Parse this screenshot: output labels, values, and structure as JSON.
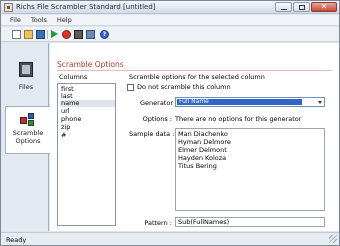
{
  "window": {
    "title": "Richs File Scrambler Standard [untitled]"
  },
  "menu": {
    "items": [
      "File",
      "Tools",
      "Help"
    ]
  },
  "toolbar": {
    "buttons": [
      "new-icon",
      "open-icon",
      "save-icon",
      "run-icon",
      "stop-icon",
      "settings-icon",
      "options-icon",
      "help-icon"
    ]
  },
  "nav": {
    "tabs": [
      {
        "label": "Files",
        "icon": "files-icon"
      },
      {
        "label": "Scramble Options",
        "icon": "scramble-icon",
        "active": true
      }
    ]
  },
  "main": {
    "section_title": "Scramble Options",
    "columns_header": "Columns",
    "columns": [
      "first",
      "last",
      "name",
      "url",
      "phone",
      "zip",
      "#"
    ],
    "selected_column": "name",
    "options_header": "Scramble options for the selected column",
    "dont_scramble_label": "Do not scramble this column",
    "dont_scramble_checked": false,
    "generator_label": "Generator :",
    "generator_value": "Full Name",
    "options_label": "Options :",
    "options_text": "There are no options for this generator",
    "sample_label": "Sample data :",
    "sample_data": [
      "Man Diachenko",
      "Hyman Delmore",
      "Elmer Delmont",
      "Hayden Koloza",
      "Titus Bering"
    ],
    "pattern_label": "Pattern :",
    "pattern_value": "Sub(FullNames)"
  },
  "status": {
    "text": "Ready"
  },
  "colors": {
    "accent": "#c0392b",
    "selection": "#2f66c7",
    "window_bg": "#dfe6ef"
  }
}
